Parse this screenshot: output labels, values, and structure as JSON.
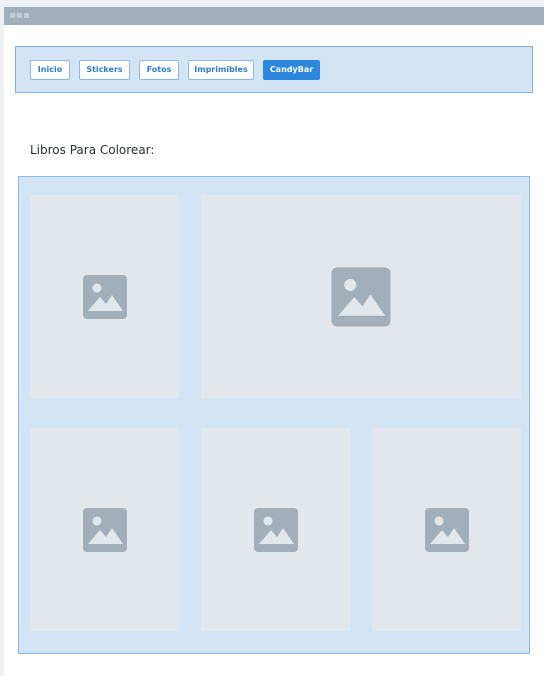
{
  "nav": {
    "items": [
      {
        "label": "Inicio",
        "active": false
      },
      {
        "label": "Stickers",
        "active": false
      },
      {
        "label": "Fotos",
        "active": false
      },
      {
        "label": "Imprimibles",
        "active": false
      },
      {
        "label": "CandyBar",
        "active": true
      }
    ]
  },
  "section": {
    "title": "Libros Para Colorear:"
  },
  "gallery": {
    "tiles": [
      {
        "icon": "image-placeholder-icon"
      },
      {
        "icon": "image-placeholder-icon"
      },
      {
        "icon": "image-placeholder-icon"
      },
      {
        "icon": "image-placeholder-icon"
      },
      {
        "icon": "image-placeholder-icon"
      }
    ]
  },
  "colors": {
    "accent": "#2d87df",
    "nav_background": "#d3e4f5",
    "tile_background": "#e2e7eb",
    "icon": "#a1afbb"
  }
}
